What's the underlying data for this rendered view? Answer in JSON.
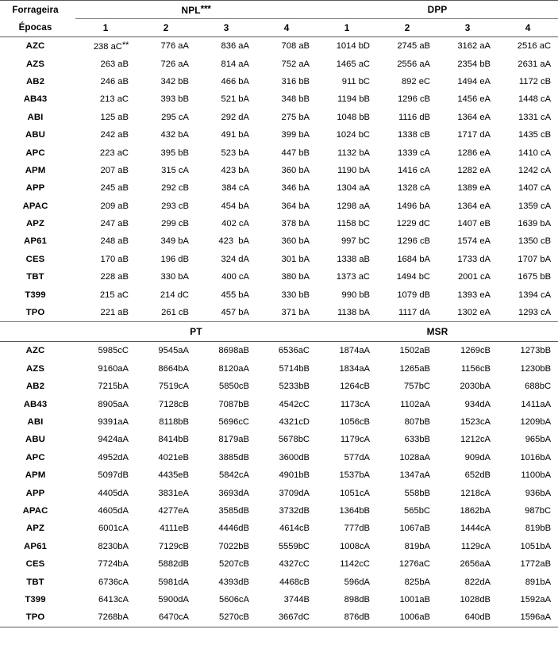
{
  "table": {
    "corner": {
      "line1": "Forrageira",
      "line2": "Épocas"
    },
    "sections": [
      {
        "id": "section-1",
        "groups": [
          {
            "label": "NPL",
            "footnote": "***"
          },
          {
            "label": "DPP",
            "footnote": ""
          }
        ],
        "epocas": [
          "1",
          "2",
          "3",
          "4",
          "1",
          "2",
          "3",
          "4"
        ],
        "rows": [
          {
            "label": "AZC",
            "values": [
              "238 aC",
              "776 aA",
              "836 aA",
              "708 aB",
              "1014 bD",
              "2745 aB",
              "3162 aA",
              "2516 aC"
            ],
            "first_footnote": "**"
          },
          {
            "label": "AZS",
            "values": [
              "263 aB",
              "726 aA",
              "814 aA",
              "752 aA",
              "1465 aC",
              "2556 aA",
              "2354 bB",
              "2631 aA"
            ]
          },
          {
            "label": "AB2",
            "values": [
              "246 aB",
              "342 bB",
              "466 bA",
              "316 bB",
              "911 bC",
              "892 eC",
              "1494 eA",
              "1172 cB"
            ]
          },
          {
            "label": "AB43",
            "values": [
              "213 aC",
              "393 bB",
              "521 bA",
              "348 bB",
              "1194 bB",
              "1296 cB",
              "1456 eA",
              "1448 cA"
            ]
          },
          {
            "label": "ABI",
            "values": [
              "125 aB",
              "295 cA",
              "292 dA",
              "275 bA",
              "1048 bB",
              "1116 dB",
              "1364 eA",
              "1331 cA"
            ]
          },
          {
            "label": "ABU",
            "values": [
              "242 aB",
              "432 bA",
              "491 bA",
              "399 bA",
              "1024 bC",
              "1338 cB",
              "1717 dA",
              "1435 cB"
            ]
          },
          {
            "label": "APC",
            "values": [
              "223 aC",
              "395 bB",
              "523 bA",
              "447 bB",
              "1132 bA",
              "1339 cA",
              "1286 eA",
              "1410 cA"
            ]
          },
          {
            "label": "APM",
            "values": [
              "207 aB",
              "315 cA",
              "423 bA",
              "360 bA",
              "1190 bA",
              "1416 cA",
              "1282 eA",
              "1242 cA"
            ]
          },
          {
            "label": "APP",
            "values": [
              "245 aB",
              "292 cB",
              "384 cA",
              "346 bA",
              "1304 aA",
              "1328 cA",
              "1389 eA",
              "1407 cA"
            ]
          },
          {
            "label": "APAC",
            "values": [
              "209 aB",
              "293 cB",
              "454 bA",
              "364 bA",
              "1298 aA",
              "1496 bA",
              "1364 eA",
              "1359 cA"
            ]
          },
          {
            "label": "APZ",
            "values": [
              "247 aB",
              "299 cB",
              "402 cA",
              "378 bA",
              "1158 bC",
              "1229 dC",
              "1407 eB",
              "1639 bA"
            ]
          },
          {
            "label": "AP61",
            "values": [
              "248 aB",
              "349 bA",
              "423  bA",
              "360 bA",
              "997 bC",
              "1296 cB",
              "1574 eA",
              "1350 cB"
            ]
          },
          {
            "label": "CES",
            "values": [
              "170 aB",
              "196 dB",
              "324 dA",
              "301 bA",
              "1338 aB",
              "1684 bA",
              "1733 dA",
              "1707 bA"
            ]
          },
          {
            "label": "TBT",
            "values": [
              "228 aB",
              "330 bA",
              "400 cA",
              "380 bA",
              "1373 aC",
              "1494 bC",
              "2001 cA",
              "1675 bB"
            ]
          },
          {
            "label": "T399",
            "values": [
              "215 aC",
              "214 dC",
              "455 bA",
              "330 bB",
              "990 bB",
              "1079 dB",
              "1393 eA",
              "1394 cA"
            ]
          },
          {
            "label": "TPO",
            "values": [
              "221 aB",
              "261 cB",
              "457 bA",
              "371 bA",
              "1138 bA",
              "1117 dA",
              "1302 eA",
              "1293 cA"
            ]
          }
        ]
      },
      {
        "id": "section-2",
        "groups": [
          {
            "label": "PT",
            "footnote": ""
          },
          {
            "label": "MSR",
            "footnote": ""
          }
        ],
        "rows": [
          {
            "label": "AZC",
            "values": [
              "5985cC",
              "9545aA",
              "8698aB",
              "6536aC",
              "1874aA",
              "1502aB",
              "1269cB",
              "1273bB"
            ]
          },
          {
            "label": "AZS",
            "values": [
              "9160aA",
              "8664bA",
              "8120aA",
              "5714bB",
              "1834aA",
              "1265aB",
              "1156cB",
              "1230bB"
            ]
          },
          {
            "label": "AB2",
            "values": [
              "7215bA",
              "7519cA",
              "5850cB",
              "5233bB",
              "1264cB",
              "757bC",
              "2030bA",
              "688bC"
            ]
          },
          {
            "label": "AB43",
            "values": [
              "8905aA",
              "7128cB",
              "7087bB",
              "4542cC",
              "1173cA",
              "1102aA",
              "934dA",
              "1411aA"
            ]
          },
          {
            "label": "ABI",
            "values": [
              "9391aA",
              "8118bB",
              "5696cC",
              "4321cD",
              "1056cB",
              "807bB",
              "1523cA",
              "1209bA"
            ]
          },
          {
            "label": "ABU",
            "values": [
              "9424aA",
              "8414bB",
              "8179aB",
              "5678bC",
              "1179cA",
              "633bB",
              "1212cA",
              "965bA"
            ]
          },
          {
            "label": "APC",
            "values": [
              "4952dA",
              "4021eB",
              "3885dB",
              "3600dB",
              "577dA",
              "1028aA",
              "909dA",
              "1016bA"
            ]
          },
          {
            "label": "APM",
            "values": [
              "5097dB",
              "4435eB",
              "5842cA",
              "4901bB",
              "1537bA",
              "1347aA",
              "652dB",
              "1100bA"
            ]
          },
          {
            "label": "APP",
            "values": [
              "4405dA",
              "3831eA",
              "3693dA",
              "3709dA",
              "1051cA",
              "558bB",
              "1218cA",
              "936bA"
            ]
          },
          {
            "label": "APAC",
            "values": [
              "4605dA",
              "4277eA",
              "3585dB",
              "3732dB",
              "1364bB",
              "565bC",
              "1862bA",
              "987bC"
            ]
          },
          {
            "label": "APZ",
            "values": [
              "6001cA",
              "4111eB",
              "4446dB",
              "4614cB",
              "777dB",
              "1067aB",
              "1444cA",
              "819bB"
            ]
          },
          {
            "label": "AP61",
            "values": [
              "8230bA",
              "7129cB",
              "7022bB",
              "5559bC",
              "1008cA",
              "819bA",
              "1129cA",
              "1051bA"
            ]
          },
          {
            "label": "CES",
            "values": [
              "7724bA",
              "5882dB",
              "5207cB",
              "4327cC",
              "1142cC",
              "1276aC",
              "2656aA",
              "1772aB"
            ]
          },
          {
            "label": "TBT",
            "values": [
              "6736cA",
              "5981dA",
              "4393dB",
              "4468cB",
              "596dA",
              "825bA",
              "822dA",
              "891bA"
            ]
          },
          {
            "label": "T399",
            "values": [
              "6413cA",
              "5900dA",
              "5606cA",
              "3744B",
              "898dB",
              "1001aB",
              "1028dB",
              "1592aA"
            ]
          },
          {
            "label": "TPO",
            "values": [
              "7268bA",
              "6470cA",
              "5270cB",
              "3667dC",
              "876dB",
              "1006aB",
              "640dB",
              "1596aA"
            ]
          }
        ]
      }
    ]
  }
}
